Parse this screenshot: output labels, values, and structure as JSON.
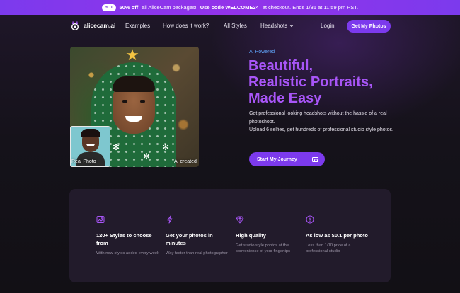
{
  "banner": {
    "hot": "HOT",
    "bold1": "50% off",
    "text1": "all AliceCam packages!",
    "bold2": "Use code WELCOME24",
    "text2": "at checkout. Ends 1/31 at 11:59 pm PST."
  },
  "nav": {
    "logo": "alicecam.ai",
    "links": [
      "Examples",
      "How does it work?",
      "All Styles",
      "Headshots"
    ],
    "login": "Login",
    "cta": "Get My Photos"
  },
  "hero": {
    "badge": "AI Powered",
    "headline": [
      "Beautiful,",
      "Realistic Portraits,",
      "Made Easy"
    ],
    "desc1": "Get professional looking headshots without the hassle of a real photoshoot.",
    "desc2": "Upload 6 selfies, get hundreds of professional studio style photos.",
    "cta": "Start My Journey",
    "real_label": "Real Photo",
    "ai_label": "AI created"
  },
  "features": [
    {
      "icon": "image-icon",
      "title": "120+ Styles to choose from",
      "desc": "With new styles added every week"
    },
    {
      "icon": "lightning-icon",
      "title": "Get your photos in minutes",
      "desc": "Way faster than real photographer"
    },
    {
      "icon": "diamond-icon",
      "title": "High quality",
      "desc": "Get studio style photos at the convenience of your fingertips"
    },
    {
      "icon": "dollar-icon",
      "title": "As low as $0.1 per photo",
      "desc": "Less than 1/10 price of a professional studio"
    }
  ],
  "colors": {
    "accent": "#7c3aed",
    "headline": "#a855f7",
    "badge": "#60a5fa"
  }
}
